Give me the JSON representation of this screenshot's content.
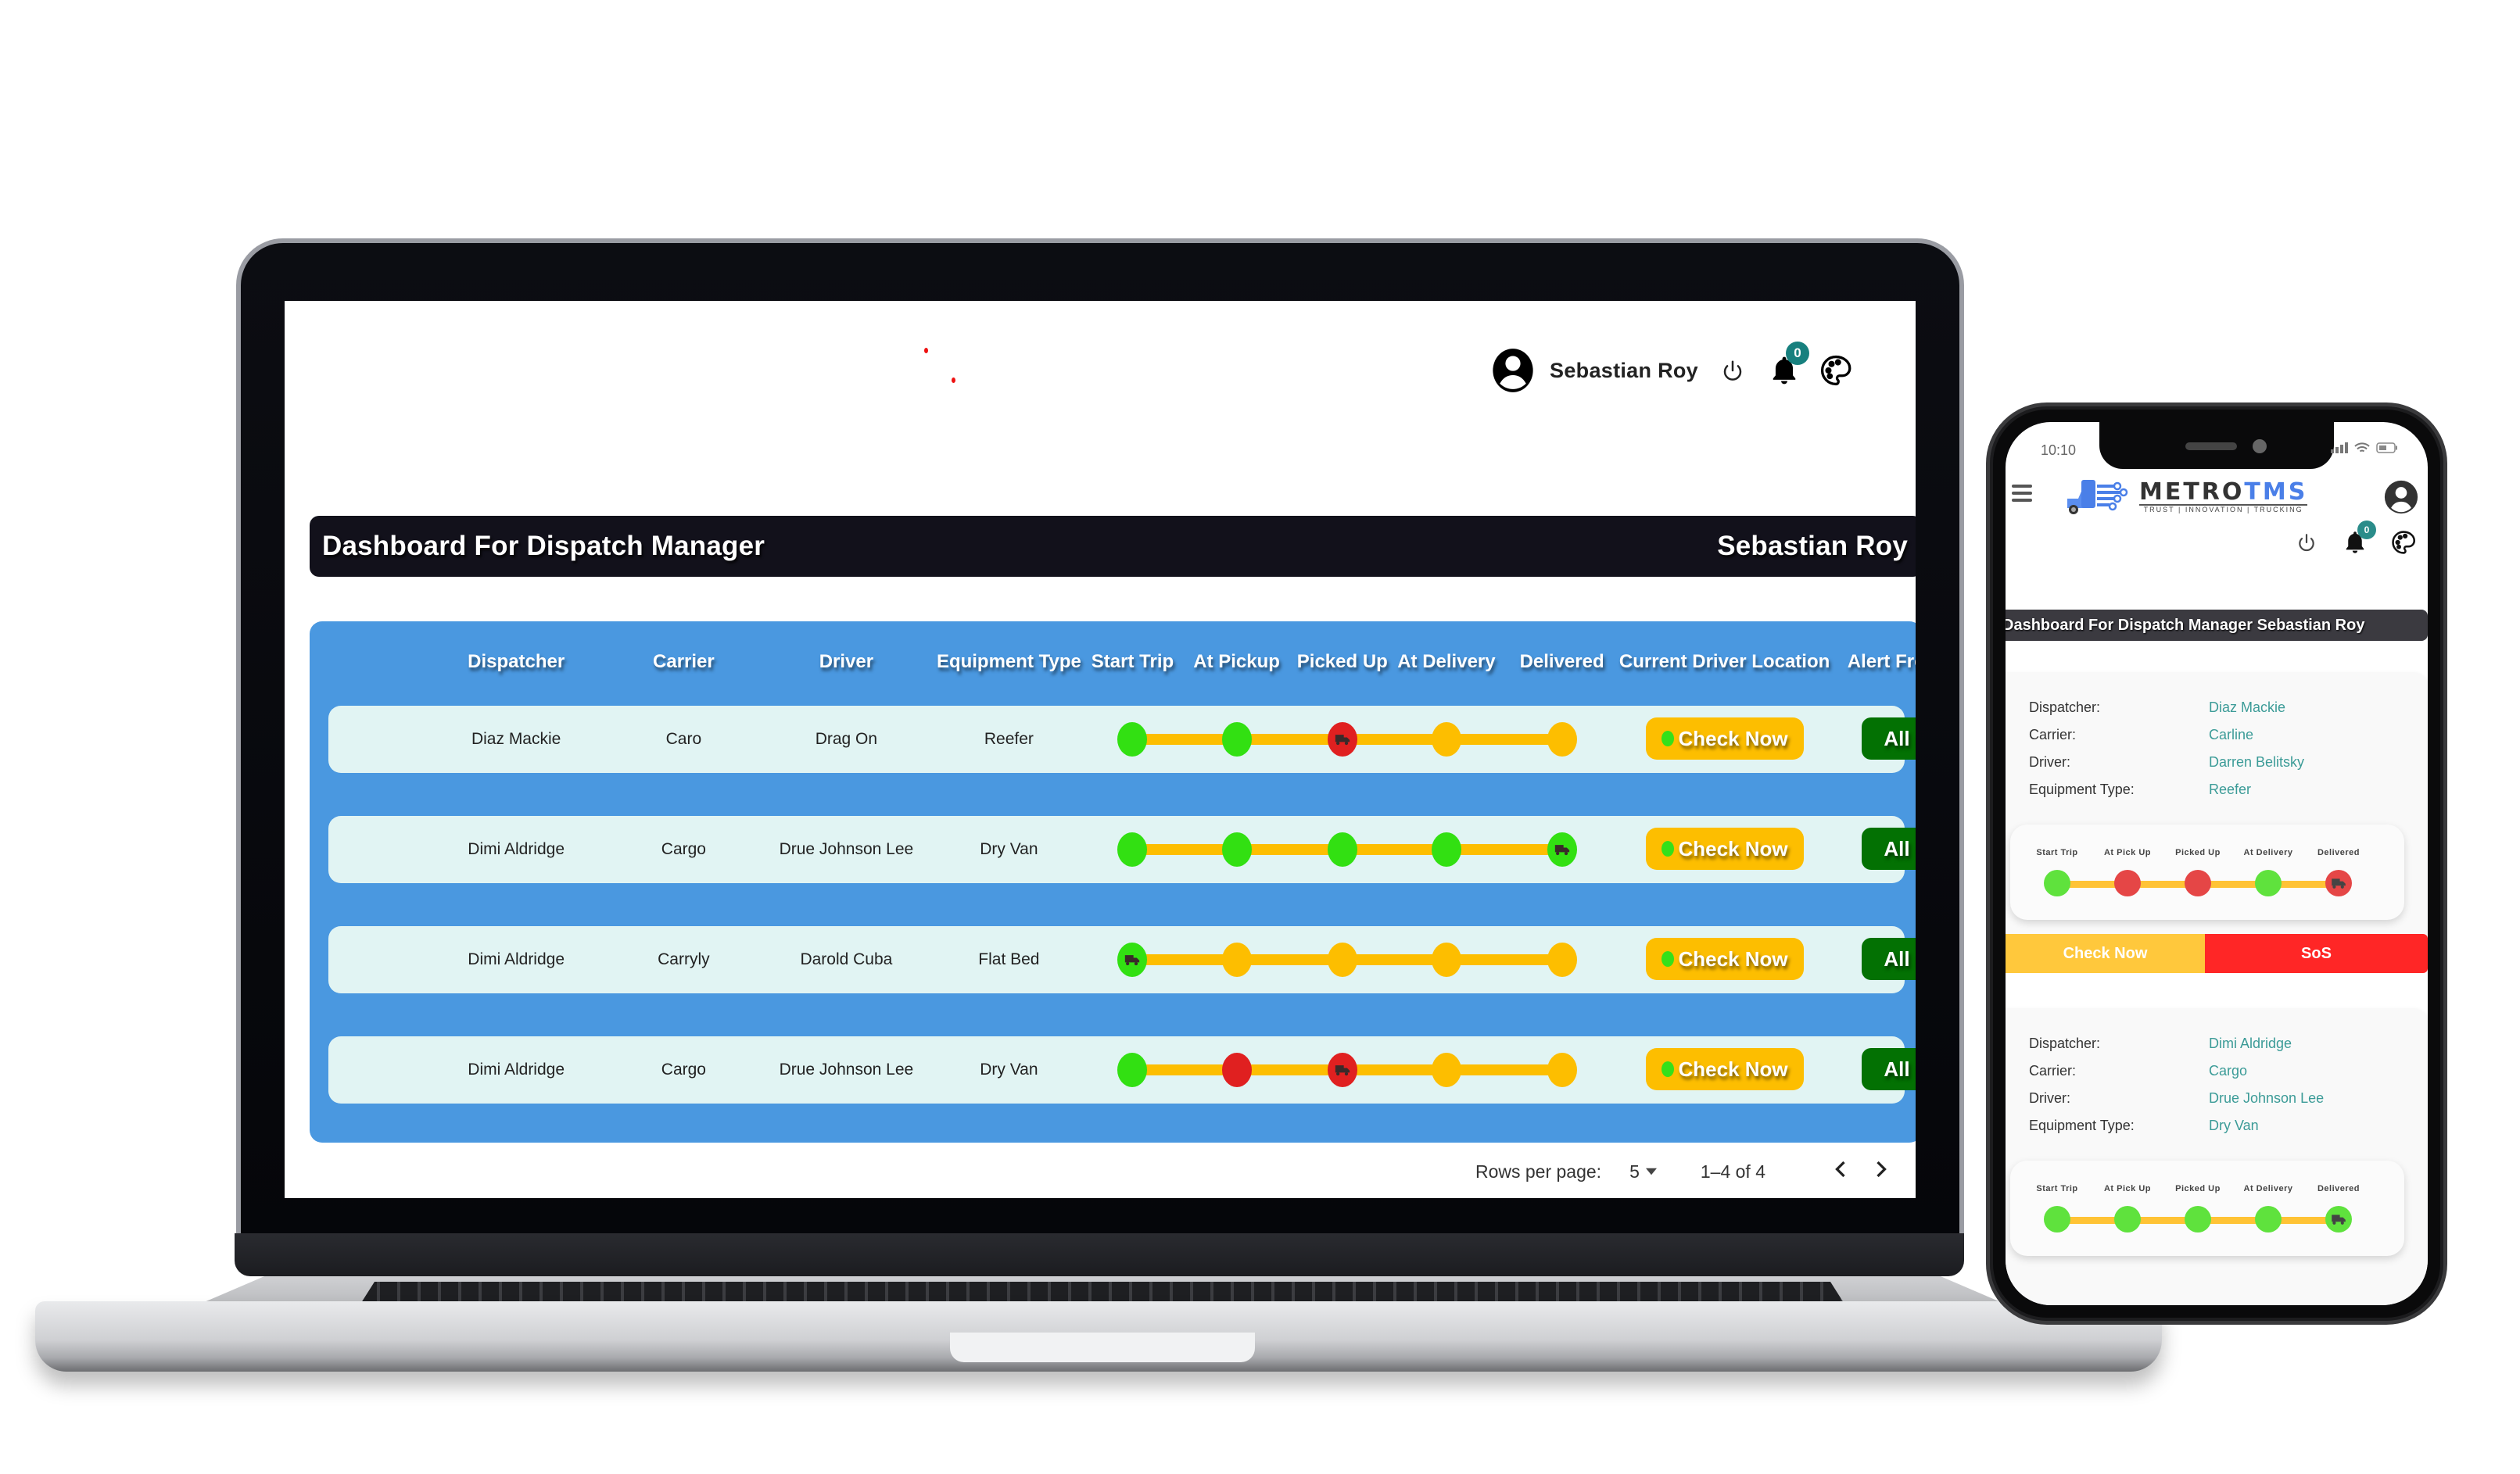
{
  "desktop": {
    "user_name": "Sebastian Roy",
    "notification_count": "0",
    "title": "Dashboard For Dispatch Manager",
    "title_user": "Sebastian Roy",
    "columns": [
      "Dispatcher",
      "Carrier",
      "Driver",
      "Equipment Type",
      "Start Trip",
      "At Pickup",
      "Picked Up",
      "At Delivery",
      "Delivered",
      "Current Driver Location",
      "Alert From Driver"
    ],
    "rows": [
      {
        "dispatcher": "Diaz Mackie",
        "carrier": "Caro",
        "driver": "Drag On",
        "equipment": "Reefer",
        "stages": [
          "green",
          "green",
          "red",
          "yellow",
          "yellow"
        ],
        "truck_at": 2,
        "location_button": "Check Now",
        "alert_button": "All Okay"
      },
      {
        "dispatcher": "Dimi Aldridge",
        "carrier": "Cargo",
        "driver": "Drue Johnson Lee",
        "equipment": "Dry Van",
        "stages": [
          "green",
          "green",
          "green",
          "green",
          "green"
        ],
        "truck_at": 4,
        "location_button": "Check Now",
        "alert_button": "All Okay"
      },
      {
        "dispatcher": "Dimi Aldridge",
        "carrier": "Carryly",
        "driver": "Darold Cuba",
        "equipment": "Flat Bed",
        "stages": [
          "green",
          "yellow",
          "yellow",
          "yellow",
          "yellow"
        ],
        "truck_at": 0,
        "location_button": "Check Now",
        "alert_button": "All Okay"
      },
      {
        "dispatcher": "Dimi Aldridge",
        "carrier": "Cargo",
        "driver": "Drue Johnson Lee",
        "equipment": "Dry Van",
        "stages": [
          "green",
          "red",
          "red",
          "yellow",
          "yellow"
        ],
        "truck_at": 2,
        "location_button": "Check Now",
        "alert_button": "All Okay"
      }
    ],
    "pagination": {
      "rows_per_page_label": "Rows per page:",
      "rows_per_page_value": "5",
      "range": "1–4 of 4",
      "prev_icon": "chevron-left",
      "next_icon": "chevron-right"
    }
  },
  "mobile": {
    "status_time": "10:10",
    "logo": {
      "part1": "METRO",
      "part2": "TMS",
      "tagline": "TRUST  |  INNOVATION  |  TRUCKING"
    },
    "notification_count": "0",
    "title": "Dashboard For Dispatch Manager Sebastian Roy",
    "labels": {
      "dispatcher": "Dispatcher:",
      "carrier": "Carrier:",
      "driver": "Driver:",
      "equipment": "Equipment Type:"
    },
    "step_labels": [
      "Start Trip",
      "At Pick Up",
      "Picked Up",
      "At Delivery",
      "Delivered"
    ],
    "cards": [
      {
        "dispatcher": "Diaz Mackie",
        "carrier": "Carline",
        "driver": "Darren Belitsky",
        "equipment": "Reefer",
        "stages": [
          "green",
          "red",
          "red",
          "green",
          "red"
        ],
        "truck_at": 4,
        "check_button": "Check Now",
        "sos_button": "SoS"
      },
      {
        "dispatcher": "Dimi Aldridge",
        "carrier": "Cargo",
        "driver": "Drue Johnson Lee",
        "equipment": "Dry Van",
        "stages": [
          "green",
          "green",
          "green",
          "green",
          "green"
        ],
        "truck_at": 4
      }
    ]
  },
  "colors": {
    "panel_blue": "#4a98e0",
    "row_bg": "#e1f4f3",
    "title_bg": "#12111b",
    "status_green": "#32e012",
    "status_red": "#e02020",
    "status_yellow": "#fdbe00",
    "check_now": "#fdbe00",
    "all_okay": "#037103",
    "sos": "#ff2626",
    "badge": "#17807e"
  }
}
